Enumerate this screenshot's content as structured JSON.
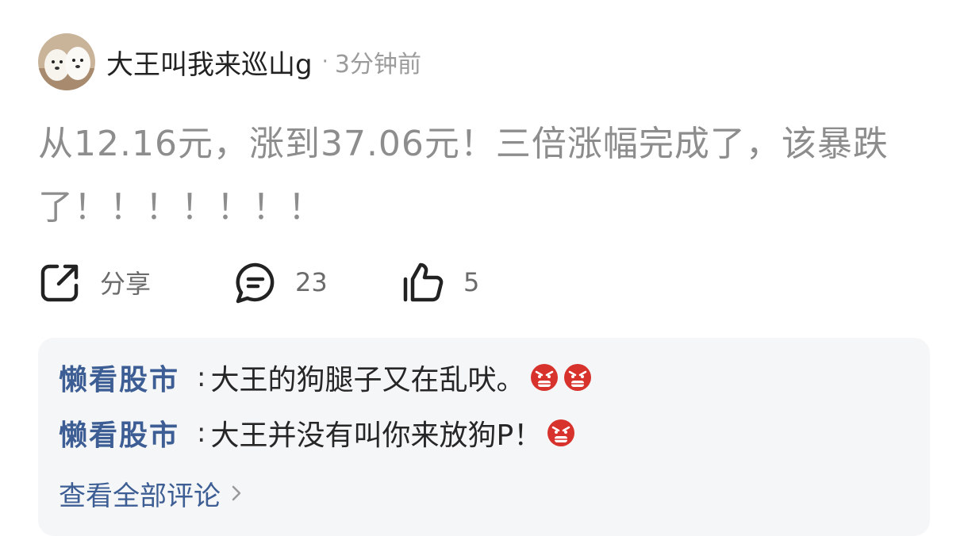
{
  "post": {
    "author": "大王叫我来巡山g",
    "separator": "·",
    "time": "3分钟前",
    "text": "从12.16元，涨到37.06元！三倍涨幅完成了，该暴跌了！！！！！！！"
  },
  "actions": {
    "share_label": "分享",
    "comment_count": "23",
    "like_count": "5"
  },
  "comments": [
    {
      "user": "懒看股市",
      "separator": ":",
      "text": "大王的狗腿子又在乱吠。",
      "emojis": [
        "angry-face-icon",
        "angry-face-icon"
      ]
    },
    {
      "user": "懒看股市",
      "separator": ":",
      "text": "大王并没有叫你来放狗P！",
      "emojis": [
        "angry-face-icon"
      ]
    }
  ],
  "view_all_label": "查看全部评论",
  "colors": {
    "link_blue": "#3d5e94",
    "post_text_gray": "#8d8d8d",
    "comment_bg": "#f5f6f7",
    "emoji_red": "#d8322c"
  }
}
